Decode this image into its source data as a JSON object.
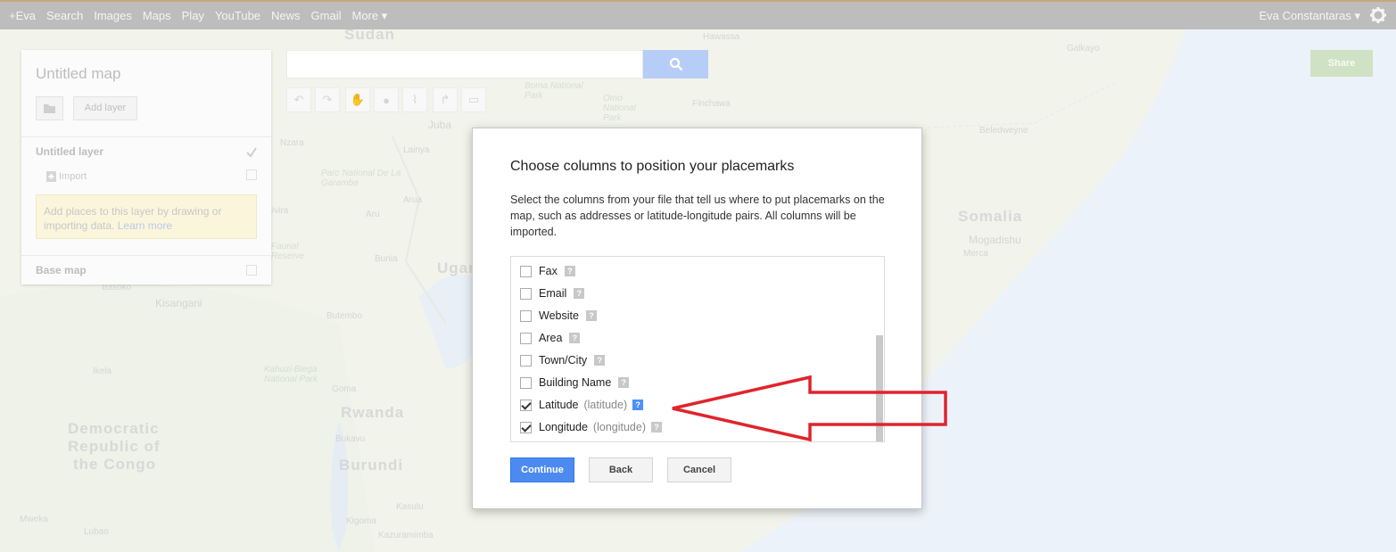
{
  "topbar": {
    "links": [
      "+Eva",
      "Search",
      "Images",
      "Maps",
      "Play",
      "YouTube",
      "News",
      "Gmail",
      "More ▾"
    ],
    "user": "Eva Constantaras ▾",
    "settings_icon": "gear-icon"
  },
  "map": {
    "labels": [
      "Sudan",
      "Somalia",
      "Mogadishu",
      "Merca",
      "Uganda",
      "Rwanda",
      "Burundi",
      "Democratic",
      "Republic of",
      "the Congo",
      "Kisangani",
      "Basoko",
      "Butembo",
      "Bunia",
      "Juba",
      "Lainya",
      "Arua",
      "Aru",
      "Nzara",
      "Ikela",
      "Goma",
      "Bukavu",
      "Kigoma",
      "Kasulu",
      "Mweka",
      "Lubao",
      "Kazuramimba",
      "Hawassa",
      "Galkayo",
      "Finchawa",
      "Beledweyne",
      "Parc National De La Garamba",
      "Kahuzi-Biega National Park",
      "Boma National Park",
      "Omo National Park",
      "Faunal Reserve",
      "Birao",
      "Kabale",
      "Butare Province",
      "Gulu",
      "Kiso",
      "Jiwa",
      "Uvira"
    ]
  },
  "panel": {
    "title": "Untitled map",
    "folder_icon": "folder-icon",
    "add_layer": "Add layer",
    "layer_name": "Untitled layer",
    "import": "Import",
    "hint_text": "Add places to this layer by drawing or importing data.",
    "hint_link": "Learn more",
    "base_map": "Base map"
  },
  "search": {
    "placeholder": "",
    "button_icon": "search-icon"
  },
  "toolbar": {
    "tools": [
      "undo-icon",
      "redo-icon",
      "hand-icon",
      "marker-icon",
      "polygon-icon",
      "directions-icon",
      "ruler-icon"
    ]
  },
  "share": "Share",
  "dialog": {
    "title": "Choose columns to position your placemarks",
    "description": "Select the columns from your file that tell us where to put placemarks on the map, such as addresses or latitude-longitude pairs. All columns will be imported.",
    "columns": [
      {
        "label": "Fax",
        "hint": "",
        "checked": false,
        "highlight": false
      },
      {
        "label": "Email",
        "hint": "",
        "checked": false,
        "highlight": false
      },
      {
        "label": "Website",
        "hint": "",
        "checked": false,
        "highlight": false
      },
      {
        "label": "Area",
        "hint": "",
        "checked": false,
        "highlight": false
      },
      {
        "label": "Town/City",
        "hint": "",
        "checked": false,
        "highlight": false
      },
      {
        "label": "Building Name",
        "hint": "",
        "checked": false,
        "highlight": false
      },
      {
        "label": "Latitude",
        "hint": "(latitude)",
        "checked": true,
        "highlight": true
      },
      {
        "label": "Longitude",
        "hint": "(longitude)",
        "checked": true,
        "highlight": false
      }
    ],
    "help_glyph": "?",
    "buttons": {
      "continue": "Continue",
      "back": "Back",
      "cancel": "Cancel"
    }
  },
  "colors": {
    "accent": "#4d8af0",
    "annotation_arrow": "#e0242b"
  }
}
